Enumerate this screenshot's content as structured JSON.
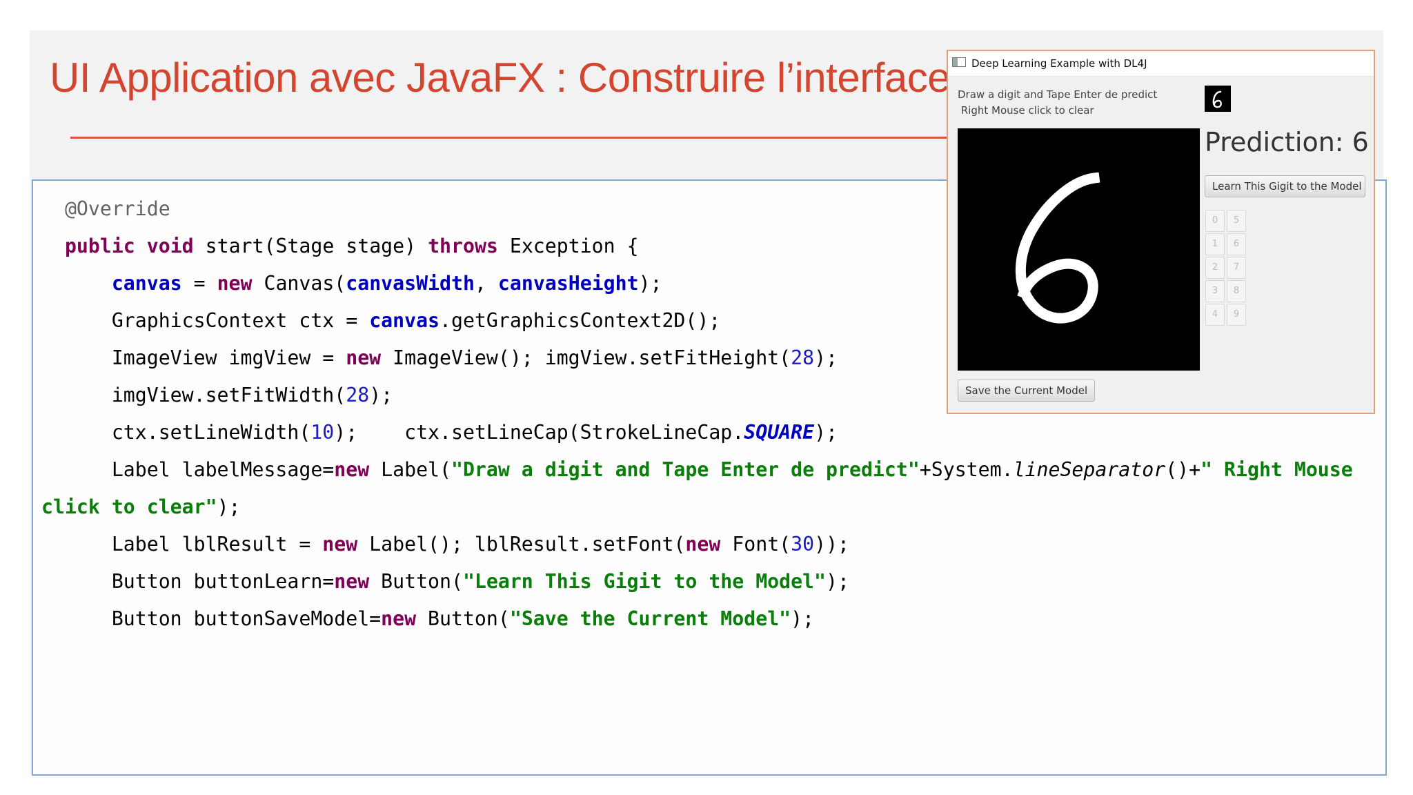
{
  "slide": {
    "title": "UI Application avec JavaFX : Construire l’interface",
    "code": {
      "l1": {
        "ann": "@Override"
      },
      "l2": {
        "kw1": "public",
        "kw2": "void",
        "t1": " start(Stage stage) ",
        "kw3": "throws",
        "t2": " Exception {"
      },
      "l3": {
        "f1": "canvas",
        "t1": " = ",
        "kw": "new",
        "t2": " Canvas(",
        "f2": "canvasWidth",
        "t3": ", ",
        "f3": "canvasHeight",
        "t4": ");"
      },
      "l4": {
        "t1": "GraphicsContext ctx = ",
        "f1": "canvas",
        "t2": ".getGraphicsContext2D();"
      },
      "l5": {
        "t1": "ImageView imgView = ",
        "kw": "new",
        "t2": " ImageView(); imgView.setFitHeight(",
        "n": "28",
        "t3": ");"
      },
      "l6": {
        "t1": "imgView.setFitWidth(",
        "n": "28",
        "t2": ");"
      },
      "l7": {
        "t1": "ctx.setLineWidth(",
        "n": "10",
        "t2": ");    ctx.setLineCap(StrokeLineCap.",
        "st": "SQUARE",
        "t3": ");"
      },
      "l8": {
        "t1": "Label labelMessage=",
        "kw": "new",
        "t2": " Label(",
        "s1": "\"Draw a digit and Tape Enter de predict\"",
        "t3": "+System.",
        "it": "lineSeparator",
        "t4": "()+",
        "s2": "\" Right Mouse"
      },
      "l9": {
        "s": "click to clear\"",
        "t": ");"
      },
      "l10": {
        "t1": "Label lblResult = ",
        "kw1": "new",
        "t2": " Label(); lblResult.setFont(",
        "kw2": "new",
        "t3": " Font(",
        "n": "30",
        "t4": "));"
      },
      "l11": {
        "t1": "Button buttonLearn=",
        "kw": "new",
        "t2": " Button(",
        "s": "\"Learn This Gigit to the Model\"",
        "t3": ");"
      },
      "l12": {
        "t1": "Button buttonSaveModel=",
        "kw": "new",
        "t2": " Button(",
        "s": "\"Save the Current Model\"",
        "t3": ");"
      }
    }
  },
  "app": {
    "window_title": "Deep Learning Example with DL4J",
    "message": "Draw a digit and Tape Enter de predict\n Right Mouse click to clear",
    "prediction": "Prediction: 6",
    "learn_button": "Learn This Gigit to the Model",
    "save_button": "Save the Current Model",
    "digit_buttons": [
      "0",
      "5",
      "1",
      "6",
      "2",
      "7",
      "3",
      "8",
      "4",
      "9"
    ],
    "drawn_digit": "6"
  },
  "colors": {
    "title": "#d2452e",
    "keyword": "#7f0055",
    "field": "#0000c0",
    "string": "#0a7e0a",
    "number": "#1c1cc4",
    "code_border": "#7ea7d4"
  }
}
